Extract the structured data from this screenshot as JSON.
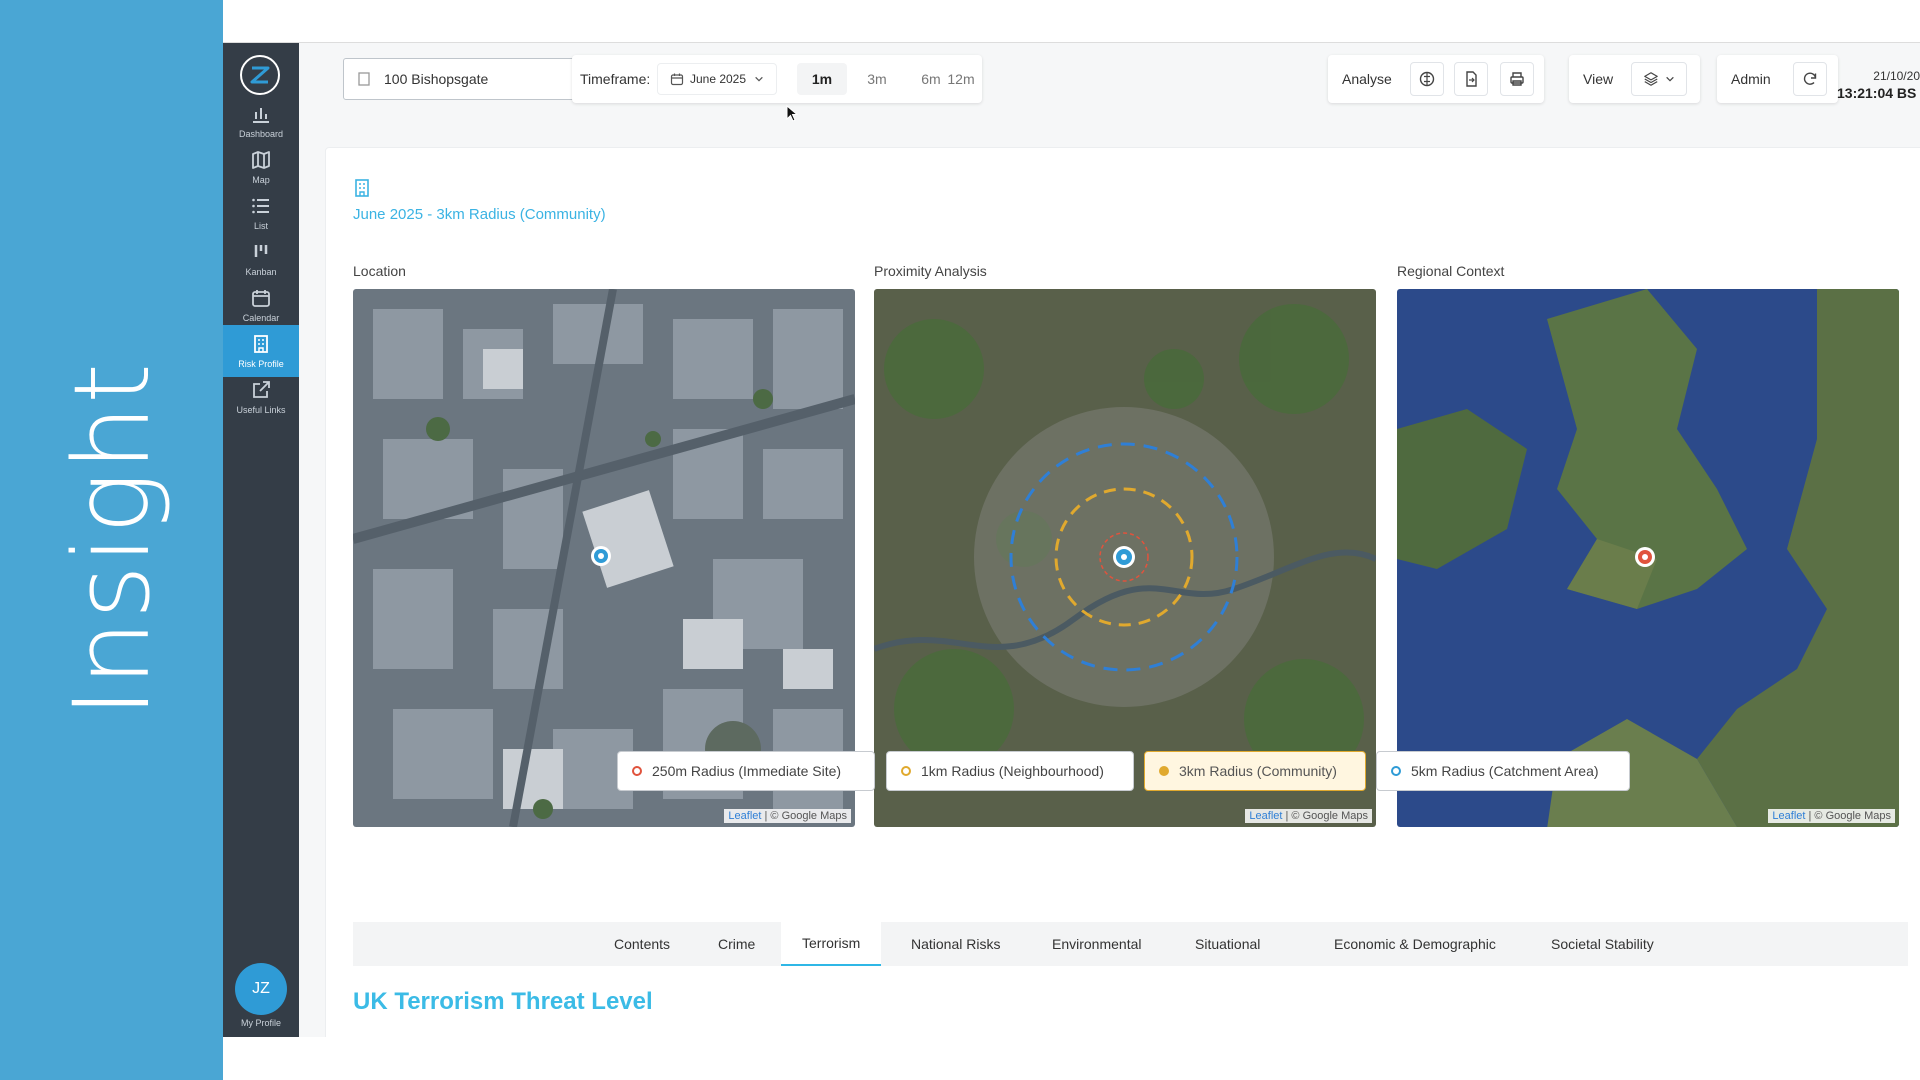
{
  "brand": {
    "word": "Insight"
  },
  "sidebar": {
    "items": [
      {
        "label": "Dashboard",
        "icon": "bar-chart-icon"
      },
      {
        "label": "Map",
        "icon": "map-icon"
      },
      {
        "label": "List",
        "icon": "list-icon"
      },
      {
        "label": "Kanban",
        "icon": "kanban-icon"
      },
      {
        "label": "Calendar",
        "icon": "calendar-icon"
      },
      {
        "label": "Risk Profile",
        "icon": "building-icon",
        "active": true
      },
      {
        "label": "Useful Links",
        "icon": "external-link-icon"
      }
    ],
    "profile": {
      "initials": "JZ",
      "label": "My Profile"
    }
  },
  "toolbar": {
    "site": "100 Bishopsgate",
    "timeframe_label": "Timeframe:",
    "month": "June 2025",
    "ranges": [
      "1m",
      "3m",
      "6m",
      "12m"
    ],
    "active_range": "1m",
    "analyse_label": "Analyse",
    "view_label": "View",
    "admin_label": "Admin",
    "date": "21/10/20",
    "time": "13:21:04 BS"
  },
  "report": {
    "subtitle": "June 2025 - 3km Radius (Community)",
    "panels": [
      {
        "title": "Location"
      },
      {
        "title": "Proximity Analysis"
      },
      {
        "title": "Regional Context"
      }
    ],
    "attribution": {
      "leaflet": "Leaflet",
      "google": "| © Google Maps"
    },
    "radius_buttons": [
      {
        "label": "250m Radius (Immediate Site)",
        "color": "#e0533d"
      },
      {
        "label": "1km Radius (Neighbourhood)",
        "color": "#e0a92e"
      },
      {
        "label": "3km Radius (Community)",
        "color": "#e0a92e",
        "active": true
      },
      {
        "label": "5km Radius (Catchment Area)",
        "color": "#2f9bd6"
      }
    ],
    "tabs": [
      "Contents",
      "Crime",
      "Terrorism",
      "National Risks",
      "Environmental",
      "Situational",
      "Economic & Demographic",
      "Societal Stability"
    ],
    "active_tab": "Terrorism",
    "section_heading": "UK Terrorism Threat Level"
  },
  "colors": {
    "brand": "#4aa6d4",
    "rail": "#343d47",
    "accent": "#2f9bd6",
    "heading": "#3bbbe6",
    "active_radius": "#e0a92e"
  }
}
